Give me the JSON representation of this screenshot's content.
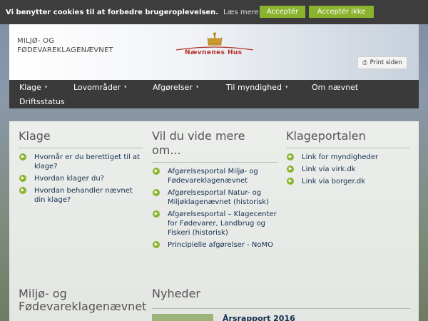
{
  "cookie_bar": {
    "message": "Vi benytter cookies til at forbedre brugeroplevelsen.",
    "more_link": "Læs mere om cookies",
    "accept_label": "Acceptér",
    "decline_label": "Acceptér ikke"
  },
  "header": {
    "site_name_line1": "MILJØ- OG",
    "site_name_line2": "FØDEVAREKLAGENÆVNET",
    "logo_text": "Nævnenes Hus",
    "print_label": "Print siden"
  },
  "nav": {
    "items": [
      {
        "label": "Klage"
      },
      {
        "label": "Lovområder"
      },
      {
        "label": "Afgørelser"
      },
      {
        "label": "Til myndighed"
      },
      {
        "label": "Om nævnet"
      },
      {
        "label": "Driftsstatus"
      }
    ]
  },
  "columns": {
    "klage": {
      "title": "Klage",
      "links": [
        "Hvornår er du berettiget til at klage?",
        "Hvordan klager du?",
        "Hvordan behandler nævnet din klage?"
      ]
    },
    "vide_mere": {
      "title": "Vil du vide mere om...",
      "links": [
        "Afgørelsesportal Miljø- og Fødevareklagenævnet",
        "Afgørelsesportal Natur- og Miljøklagenævnet (historisk)",
        "Afgørelsesportal – Klagecenter for Fødevarer, Landbrug og Fiskeri (historisk)",
        "Principielle afgørelser - NoMO"
      ]
    },
    "klageportalen": {
      "title": "Klageportalen",
      "links": [
        "Link for myndigheder",
        "Link via virk.dk",
        "Link via borger.dk"
      ]
    }
  },
  "bottom": {
    "left_title": "Miljø- og Fødevareklagenævnet",
    "news_title": "Nyheder",
    "news_headline": "Årsrapport 2016"
  }
}
